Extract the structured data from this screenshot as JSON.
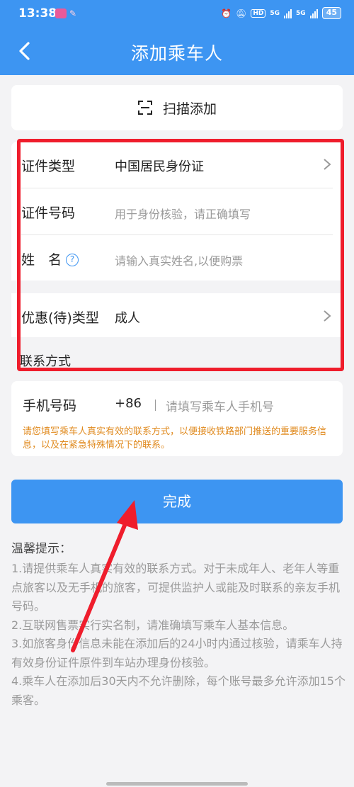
{
  "status_bar": {
    "time": "13:38",
    "battery": "45",
    "hd_badge": "HD",
    "network_1": "5G",
    "network_2": "5G"
  },
  "header": {
    "title": "添加乘车人"
  },
  "scan": {
    "label": "扫描添加"
  },
  "form": {
    "id_type": {
      "label": "证件类型",
      "value": "中国居民身份证"
    },
    "id_number": {
      "label": "证件号码",
      "placeholder": "用于身份核验，请正确填写"
    },
    "name": {
      "label": "姓　名",
      "help": "?",
      "placeholder": "请输入真实姓名,以便购票"
    },
    "discount_type": {
      "label": "优惠(待)类型",
      "value": "成人"
    }
  },
  "contact": {
    "section_label": "联系方式",
    "phone_label": "手机号码",
    "country_code": "+86",
    "phone_placeholder": "请填写乘车人手机号",
    "note": "请您填写乘车人真实有效的联系方式，以便接收铁路部门推送的重要服务信息，以及在紧急特殊情况下的联系。"
  },
  "done_button": "完成",
  "tips": {
    "title": "温馨提示：",
    "items": [
      "1.请提供乘车人真实有效的联系方式。对于未成年人、老年人等重点旅客以及无手机的旅客，可提供监护人或能及时联系的亲友手机号码。",
      "2.互联网售票实行实名制，请准确填写乘车人基本信息。",
      "3.如旅客身份信息未能在添加后的24小时内通过核验，请乘车人持有效身份证件原件到车站办理身份核验。",
      "4.乘车人在添加后30天内不允许删除，每个账号最多允许添加15个乘客。"
    ]
  },
  "colors": {
    "primary": "#3d95f2",
    "highlight": "#ef1d2c",
    "note": "#e08a1e"
  }
}
